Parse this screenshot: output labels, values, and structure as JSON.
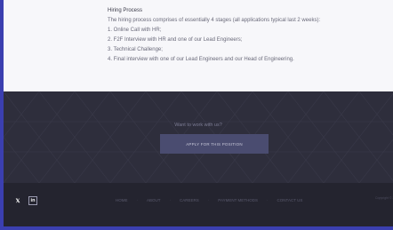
{
  "hiring": {
    "title": "Hiring Process",
    "intro": "The hiring process comprises of essentially 4 stages (all applications typical last 2 weeks):",
    "steps": [
      "1. Online Call with HR;",
      "2. F2F Interview with HR and one of our Lead Engineers;",
      "3. Technical Challenge;",
      "4. Final interview with one of our Lead Engineers and our Head of Engineering."
    ]
  },
  "cta": {
    "prompt": "Want to work with us?",
    "button_label": "APPLY FOR THIS POSITION"
  },
  "footer": {
    "social": {
      "twitter": "𝕏",
      "linkedin": "in"
    },
    "nav": [
      "HOME",
      "ABOUT",
      "CAREERS",
      "PAYMENT METHODS",
      "CONTACT US"
    ],
    "copyright": "Copyright © 20"
  },
  "colors": {
    "accent_bar": "#3b3fb0",
    "cta_background": "#2e2e3c",
    "button_background": "#4a4c70",
    "footer_background": "#24242f"
  },
  "icons": [
    "twitter-icon",
    "linkedin-icon"
  ]
}
